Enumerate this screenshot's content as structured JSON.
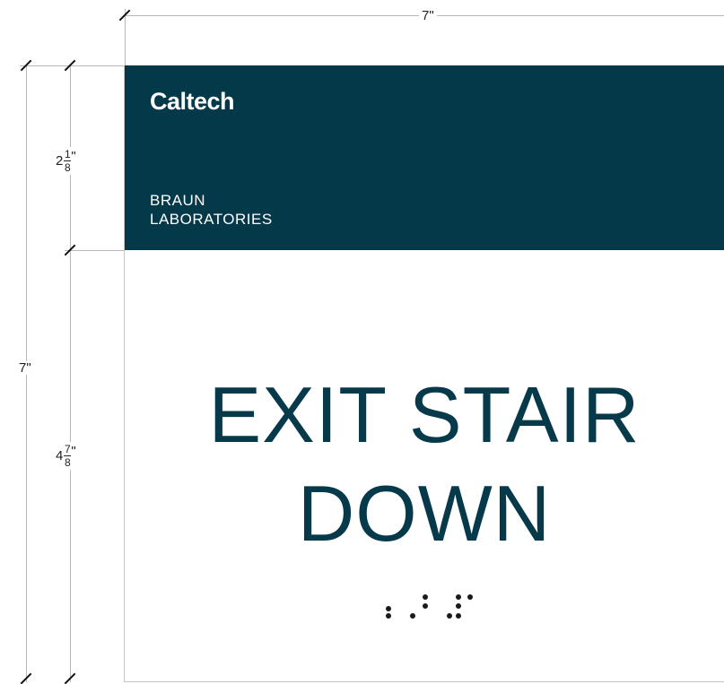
{
  "dimensions": {
    "width_label": "7\"",
    "height_label": "7\"",
    "header_height": {
      "whole": "2",
      "numerator": "1",
      "denominator": "8",
      "suffix": "\""
    },
    "body_height": {
      "whole": "4",
      "numerator": "7",
      "denominator": "8",
      "suffix": "\""
    }
  },
  "sign": {
    "brand": "Caltech",
    "building_line1": "BRAUN",
    "building_line2": "LABORATORIES",
    "message_line1": "EXIT STAIR",
    "message_line2": "DOWN",
    "braille_label": "braille: exit stair down"
  },
  "colors": {
    "header_band": "#04394a",
    "message_text": "#06394a"
  }
}
